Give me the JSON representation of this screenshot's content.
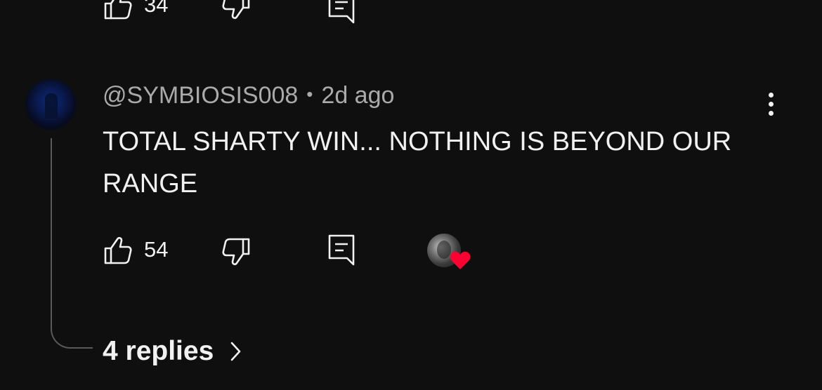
{
  "previous_comment": {
    "like_count": "34"
  },
  "comment": {
    "author": "@SYMBIOSIS008",
    "separator": "•",
    "time": "2d ago",
    "text": "TOTAL SHARTY WIN... NOTHING IS BEYOND OUR RANGE",
    "like_count": "54",
    "replies_label": "4 replies"
  },
  "icons": {
    "like": "thumbs-up-icon",
    "dislike": "thumbs-down-icon",
    "reply": "reply-comment-icon",
    "more": "more-vert-icon",
    "chevron": "chevron-right-icon",
    "heart": "heart-icon"
  },
  "colors": {
    "background": "#0f0f0f",
    "text": "#f1f1f1",
    "secondary_text": "#aaaaaa",
    "heart": "#ff0033"
  }
}
